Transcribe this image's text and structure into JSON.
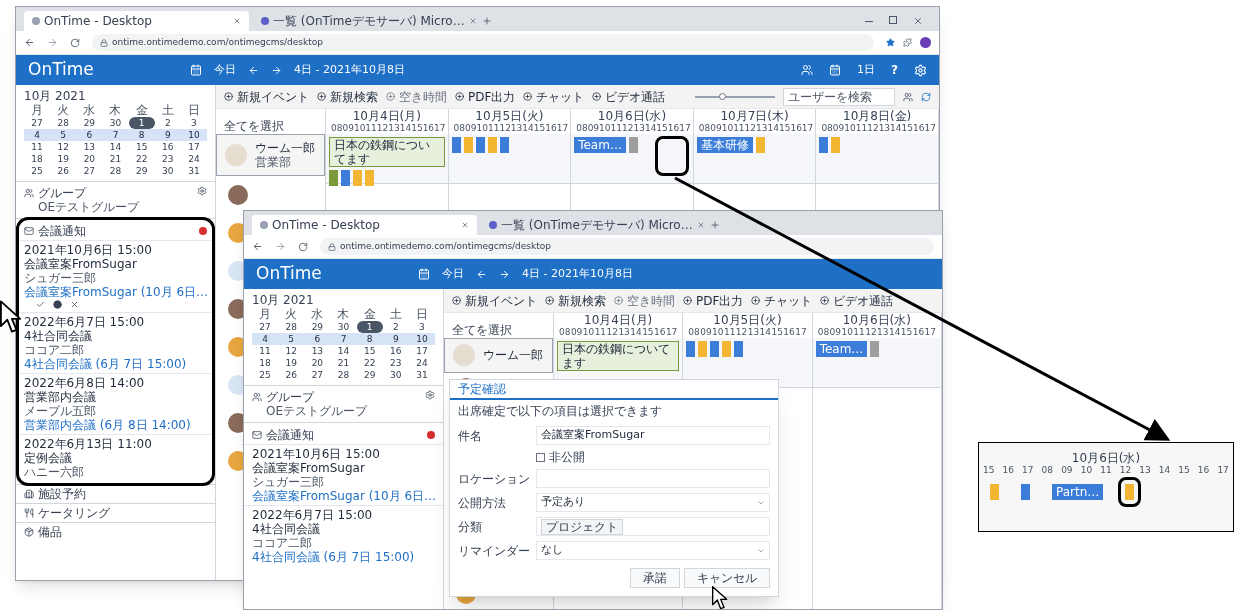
{
  "windows": [
    {
      "tabs": [
        {
          "label": "OnTime - Desktop",
          "selected": true
        },
        {
          "label": "一覧 (OnTimeデモサーバ) Micro…",
          "selected": false
        }
      ],
      "url": "ontime.ontimedemo.com/ontimegcms/desktop",
      "logo": "OnTime",
      "today": "今日",
      "range": "4日 - 2021年10月8日",
      "view": "1日",
      "help": "?",
      "toolbar": [
        {
          "label": "新規イベント",
          "disabled": false
        },
        {
          "label": "新規検索",
          "disabled": false
        },
        {
          "label": "空き時間",
          "disabled": true
        },
        {
          "label": "PDF出力",
          "disabled": false
        },
        {
          "label": "チャット",
          "disabled": false
        },
        {
          "label": "ビデオ通話",
          "disabled": false
        }
      ],
      "zoom": {
        "level": 0.35
      },
      "search_placeholder": "ユーザーを検索",
      "calendar": {
        "month": "10月 2021",
        "weekdays": [
          "月",
          "火",
          "水",
          "木",
          "金",
          "土",
          "日"
        ],
        "weeks": [
          {
            "selected": false,
            "days": [
              {
                "label": "27",
                "today": false
              },
              {
                "label": "28",
                "today": false
              },
              {
                "label": "29",
                "today": false
              },
              {
                "label": "30",
                "today": false
              },
              {
                "label": "1",
                "today": true
              },
              {
                "label": "2",
                "today": false
              },
              {
                "label": "3",
                "today": false
              }
            ]
          },
          {
            "selected": true,
            "days": [
              {
                "label": "4",
                "today": false
              },
              {
                "label": "5",
                "today": false
              },
              {
                "label": "6",
                "today": false
              },
              {
                "label": "7",
                "today": false
              },
              {
                "label": "8",
                "today": false
              },
              {
                "label": "9",
                "today": false
              },
              {
                "label": "10",
                "today": false
              }
            ]
          },
          {
            "selected": false,
            "days": [
              {
                "label": "11",
                "today": false
              },
              {
                "label": "12",
                "today": false
              },
              {
                "label": "13",
                "today": false
              },
              {
                "label": "14",
                "today": false
              },
              {
                "label": "15",
                "today": false
              },
              {
                "label": "16",
                "today": false
              },
              {
                "label": "17",
                "today": false
              }
            ]
          },
          {
            "selected": false,
            "days": [
              {
                "label": "18",
                "today": false
              },
              {
                "label": "19",
                "today": false
              },
              {
                "label": "20",
                "today": false
              },
              {
                "label": "21",
                "today": false
              },
              {
                "label": "22",
                "today": false
              },
              {
                "label": "23",
                "today": false
              },
              {
                "label": "24",
                "today": false
              }
            ]
          },
          {
            "selected": false,
            "days": [
              {
                "label": "25",
                "today": false
              },
              {
                "label": "26",
                "today": false
              },
              {
                "label": "27",
                "today": false
              },
              {
                "label": "28",
                "today": false
              },
              {
                "label": "29",
                "today": false
              },
              {
                "label": "30",
                "today": false
              },
              {
                "label": "31",
                "today": false
              }
            ]
          }
        ]
      },
      "group": {
        "title": "グループ",
        "subtitle": "OEテストグループ"
      },
      "notifications": {
        "title": "会議通知",
        "unread": true,
        "items": [
          {
            "date": "2021年10月6日 15:00",
            "subject": "会議室案FromSugar",
            "person": "シュガー三郎",
            "link": "会議室案FromSugar (10月 6日…",
            "actions": true
          },
          {
            "date": "2022年6月7日 15:00",
            "subject": "4社合同会議",
            "person": "ココア二郎",
            "link": "4社合同会議 (6月 7日 15:00)",
            "actions": false
          },
          {
            "date": "2022年6月8日 14:00",
            "subject": "営業部内会議",
            "person": "メープル五郎",
            "link": "営業部内会議 (6月 8日 14:00)",
            "actions": false
          },
          {
            "date": "2022年6月13日 11:00",
            "subject": "定例会議",
            "person": "ハニー六郎",
            "actions": false
          }
        ]
      },
      "footer": [
        "施設予約",
        "ケータリング",
        "備品"
      ],
      "select_all": "全てを選択",
      "days": [
        {
          "label": "10月4日(月)",
          "hours": [
            "08",
            "09",
            "10",
            "11",
            "12",
            "13",
            "14",
            "15",
            "16",
            "17"
          ]
        },
        {
          "label": "10月5日(火)",
          "hours": [
            "08",
            "09",
            "10",
            "11",
            "12",
            "13",
            "14",
            "15",
            "16",
            "17"
          ]
        },
        {
          "label": "10月6日(水)",
          "hours": [
            "08",
            "09",
            "10",
            "11",
            "12",
            "13",
            "14",
            "15",
            "16",
            "17"
          ]
        },
        {
          "label": "10月7日(木)",
          "hours": [
            "08",
            "09",
            "10",
            "11",
            "12",
            "13",
            "14",
            "15",
            "16",
            "17"
          ]
        },
        {
          "label": "10月8日(金)",
          "hours": [
            "08",
            "09",
            "10",
            "11",
            "12",
            "13",
            "14",
            "15",
            "16",
            "17"
          ]
        }
      ],
      "person": {
        "name": "ウーム一郎",
        "dept": "営業部",
        "selected": true,
        "days": [
          [
            {
              "kind": "note",
              "label": "日本の鉄鋼についてます",
              "color": "#e6f0dc"
            },
            {
              "kind": "block",
              "color": "#7a9a3a"
            },
            {
              "kind": "block",
              "color": "#3b7dd8"
            },
            {
              "kind": "block",
              "color": "#f2b632"
            },
            {
              "kind": "block",
              "color": "#f2b632"
            }
          ],
          [
            {
              "kind": "block",
              "color": "#3b7dd8"
            },
            {
              "kind": "block",
              "color": "#f2b632"
            },
            {
              "kind": "block",
              "color": "#3b7dd8"
            },
            {
              "kind": "block",
              "color": "#f2b632"
            },
            {
              "kind": "block",
              "color": "#3b7dd8"
            }
          ],
          [
            {
              "kind": "block",
              "label": "Team…",
              "color": "#3b7dd8"
            },
            {
              "kind": "block",
              "color": "#9e9e9e"
            }
          ],
          [
            {
              "kind": "block",
              "label": "基本研修",
              "color": "#3b7dd8"
            },
            {
              "kind": "block",
              "color": "#f2b632"
            }
          ],
          [
            {
              "kind": "block",
              "color": "#3b7dd8"
            },
            {
              "kind": "block",
              "color": "#f2b632"
            }
          ]
        ]
      }
    },
    {
      "tabs": [
        {
          "label": "OnTime - Desktop",
          "selected": true
        },
        {
          "label": "一覧 (OnTimeデモサーバ) Micro…",
          "selected": false
        }
      ],
      "url": "ontime.ontimedemo.com/ontimegcms/desktop",
      "logo": "OnTime",
      "today": "今日",
      "range": "4日 - 2021年10月8日",
      "toolbar": [
        {
          "label": "新規イベント",
          "disabled": false
        },
        {
          "label": "新規検索",
          "disabled": false
        },
        {
          "label": "空き時間",
          "disabled": true
        },
        {
          "label": "PDF出力",
          "disabled": false
        },
        {
          "label": "チャット",
          "disabled": false
        },
        {
          "label": "ビデオ通話",
          "disabled": false
        }
      ],
      "calendar": {
        "month": "10月 2021",
        "weekdays": [
          "月",
          "火",
          "水",
          "木",
          "金",
          "土",
          "日"
        ],
        "weeks": [
          {
            "selected": false,
            "days": [
              {
                "label": "27",
                "today": false
              },
              {
                "label": "28",
                "today": false
              },
              {
                "label": "29",
                "today": false
              },
              {
                "label": "30",
                "today": false
              },
              {
                "label": "1",
                "today": true
              },
              {
                "label": "2",
                "today": false
              },
              {
                "label": "3",
                "today": false
              }
            ]
          },
          {
            "selected": true,
            "days": [
              {
                "label": "4",
                "today": false
              },
              {
                "label": "5",
                "today": false
              },
              {
                "label": "6",
                "today": false
              },
              {
                "label": "7",
                "today": false
              },
              {
                "label": "8",
                "today": false
              },
              {
                "label": "9",
                "today": false
              },
              {
                "label": "10",
                "today": false
              }
            ]
          },
          {
            "selected": false,
            "days": [
              {
                "label": "11",
                "today": false
              },
              {
                "label": "12",
                "today": false
              },
              {
                "label": "13",
                "today": false
              },
              {
                "label": "14",
                "today": false
              },
              {
                "label": "15",
                "today": false
              },
              {
                "label": "16",
                "today": false
              },
              {
                "label": "17",
                "today": false
              }
            ]
          },
          {
            "selected": false,
            "days": [
              {
                "label": "18",
                "today": false
              },
              {
                "label": "19",
                "today": false
              },
              {
                "label": "20",
                "today": false
              },
              {
                "label": "21",
                "today": false
              },
              {
                "label": "22",
                "today": false
              },
              {
                "label": "23",
                "today": false
              },
              {
                "label": "24",
                "today": false
              }
            ]
          },
          {
            "selected": false,
            "days": [
              {
                "label": "25",
                "today": false
              },
              {
                "label": "26",
                "today": false
              },
              {
                "label": "27",
                "today": false
              },
              {
                "label": "28",
                "today": false
              },
              {
                "label": "29",
                "today": false
              },
              {
                "label": "30",
                "today": false
              },
              {
                "label": "31",
                "today": false
              }
            ]
          }
        ]
      },
      "group": {
        "title": "グループ",
        "subtitle": "OEテストグループ"
      },
      "notifications": {
        "title": "会議通知",
        "unread": true,
        "items": [
          {
            "date": "2021年10月6日 15:00",
            "subject": "会議室案FromSugar",
            "person": "シュガー三郎",
            "link": "会議室案FromSugar (10月 6日…",
            "actions": false
          },
          {
            "date": "2022年6月7日 15:00",
            "subject": "4社合同会議",
            "person": "ココア二郎",
            "link": "4社合同会議 (6月 7日 15:00)",
            "actions": false
          }
        ]
      },
      "select_all": "全てを選択",
      "days": [
        {
          "label": "10月4日(月)",
          "hours": [
            "08",
            "09",
            "10",
            "11",
            "12",
            "13",
            "14",
            "15",
            "16",
            "17"
          ]
        },
        {
          "label": "10月5日(火)",
          "hours": [
            "08",
            "09",
            "10",
            "11",
            "12",
            "13",
            "14",
            "15",
            "16",
            "17"
          ]
        },
        {
          "label": "10月6日(水)",
          "hours": [
            "08",
            "09",
            "10",
            "11",
            "12",
            "13",
            "14",
            "15",
            "16",
            "17"
          ]
        }
      ],
      "person": {
        "name": "ウーム一郎",
        "selected": true,
        "days": [
          [
            {
              "kind": "note",
              "label": "日本の鉄鋼についてます",
              "color": "#e6f0dc"
            }
          ],
          [
            {
              "kind": "block",
              "color": "#3b7dd8"
            },
            {
              "kind": "block",
              "color": "#f2b632"
            },
            {
              "kind": "block",
              "color": "#3b7dd8"
            },
            {
              "kind": "block",
              "color": "#f2b632"
            },
            {
              "kind": "block",
              "color": "#3b7dd8"
            }
          ],
          [
            {
              "kind": "block",
              "label": "Team…",
              "color": "#3b7dd8"
            },
            {
              "kind": "block",
              "color": "#9e9e9e"
            }
          ]
        ]
      },
      "dialog": {
        "title": "予定確認",
        "note": "出席確定で以下の項目は選択できます",
        "fields": [
          {
            "kind": "text",
            "label": "件名",
            "value": "会議室案FromSugar"
          },
          {
            "kind": "checkbox",
            "label": "非公開",
            "checked": false
          },
          {
            "kind": "text",
            "label": "ロケーション"
          },
          {
            "kind": "select",
            "label": "公開方法",
            "value": "予定あり"
          },
          {
            "kind": "tag",
            "label": "分類",
            "value": "プロジェクト"
          },
          {
            "kind": "select",
            "label": "リマインダー",
            "value": "なし"
          }
        ],
        "buttons": [
          "承諾",
          "キャンセル"
        ]
      }
    }
  ],
  "inset": {
    "day": "10月6日(水)",
    "hours": [
      "15",
      "16",
      "17",
      "08",
      "09",
      "10",
      "11",
      "12",
      "13",
      "14",
      "15",
      "16",
      "17"
    ],
    "events": [
      {
        "kind": "block",
        "color": "#f2b632",
        "highlighted": false
      },
      {
        "kind": "block",
        "color": "#3b7dd8",
        "highlighted": false
      },
      {
        "kind": "block",
        "label": "Partn…",
        "color": "#3b7dd8",
        "highlighted": false
      },
      {
        "kind": "block",
        "color": "#f2b632",
        "highlighted": true
      }
    ]
  }
}
